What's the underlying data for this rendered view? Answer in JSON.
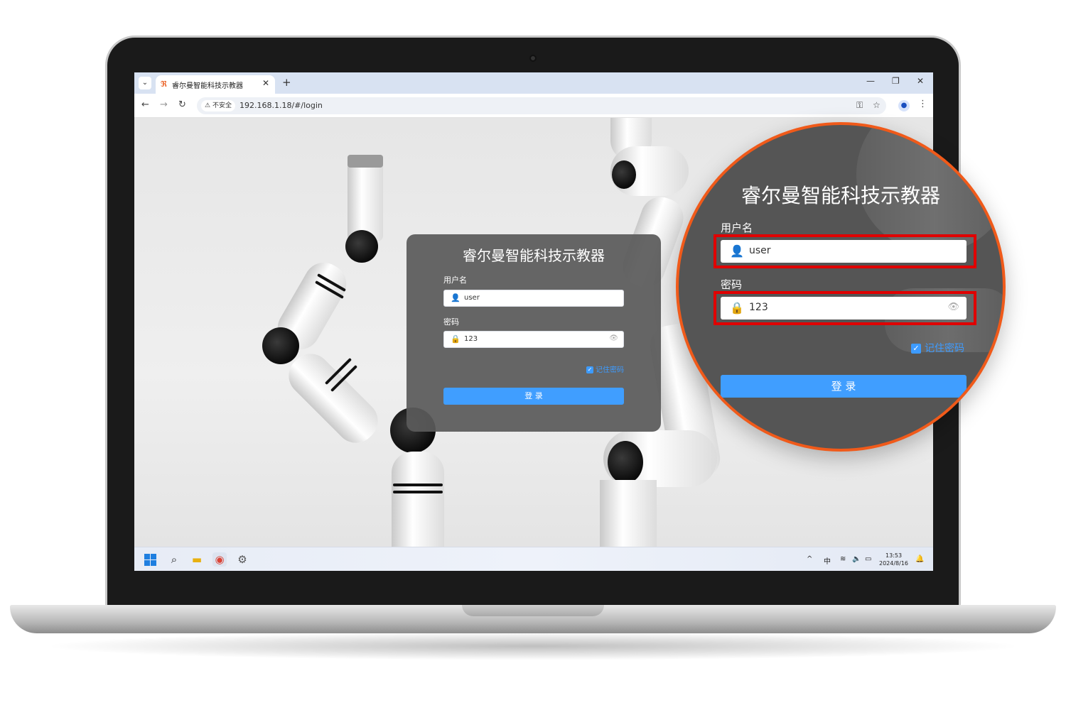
{
  "browser": {
    "tab_menu_icon": "chevron-down-icon",
    "tab_favicon": "ruiman-logo-icon",
    "tab_title": "睿尔曼智能科技示教器",
    "tab_close": "✕",
    "new_tab": "+",
    "window_controls": {
      "minimize": "—",
      "restore": "❐",
      "close": "✕"
    },
    "nav": {
      "back": "←",
      "forward": "→",
      "reload": "↻"
    },
    "security_label": "不安全",
    "url": "192.168.1.18/#/login",
    "icons": [
      "key-icon",
      "star-icon",
      "profile-icon",
      "more-menu-icon"
    ]
  },
  "login": {
    "title": "睿尔曼智能科技示教器",
    "username_label": "用户名",
    "username_value": "user",
    "password_label": "密码",
    "password_value": "123",
    "remember_label": "记住密码",
    "remember_checked": true,
    "submit_label": "登 录"
  },
  "taskbar": {
    "apps": [
      "windows-start-icon",
      "search-icon",
      "file-explorer-icon",
      "chrome-icon",
      "settings-app-icon"
    ],
    "tray_chevron": "^",
    "ime": "中",
    "time": "13:53",
    "date": "2024/8/16"
  },
  "colors": {
    "accent": "#409eff",
    "highlight_box": "#e00000",
    "magnifier_ring": "#f05a1a",
    "card_bg": "#5a5a5a"
  }
}
